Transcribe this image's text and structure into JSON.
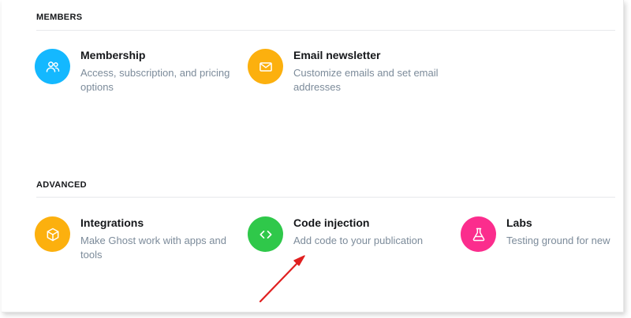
{
  "sections": {
    "members": {
      "title": "MEMBERS",
      "items": [
        {
          "title": "Membership",
          "description": "Access, subscription, and pricing options",
          "color": "#14b8ff",
          "icon": "members-icon"
        },
        {
          "title": "Email newsletter",
          "description": "Customize emails and set email addresses",
          "color": "#fcb00e",
          "icon": "envelope-icon"
        }
      ]
    },
    "advanced": {
      "title": "ADVANCED",
      "items": [
        {
          "title": "Integrations",
          "description": "Make Ghost work with apps and tools",
          "color": "#fcb00e",
          "icon": "box-icon"
        },
        {
          "title": "Code injection",
          "description": "Add code to your publication",
          "color": "#2fc84a",
          "icon": "code-icon"
        },
        {
          "title": "Labs",
          "description": "Testing ground for new",
          "color": "#fb2d8d",
          "icon": "flask-icon"
        }
      ]
    }
  },
  "annotation": {
    "arrow_color": "#e02020"
  }
}
